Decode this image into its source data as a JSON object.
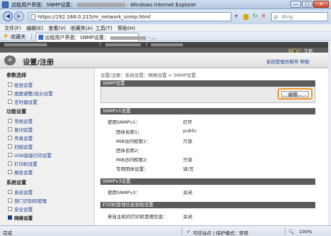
{
  "window": {
    "title": "远程用户界面：SNMP设置：",
    "title_suffix": "- Windows Internet Explorer",
    "min": "—",
    "max": "□",
    "close": "✕"
  },
  "address": {
    "back": "◀",
    "forward": "▶",
    "url_prefix": "https://192.168.0.215/",
    "url_suffix": "m_network_snmp.html",
    "search_placeholder": "Bing",
    "go_icon": "▾",
    "refresh_icon": "↻",
    "stop_icon": "✕",
    "search_icon": "ρ"
  },
  "menu": [
    "文件(F)",
    "编辑(E)",
    "查看(V)",
    "收藏夹(A)",
    "工具(T)",
    "帮助(H)"
  ],
  "favbar": {
    "label": "收藏夹",
    "star_icon": "★",
    "tab_label": "远程用户界面：SNMP设置：",
    "tab_suffix": "- ..."
  },
  "page": {
    "slash": "/",
    "logout_label": "到门户",
    "logout_link": "注销",
    "logo": "✳",
    "header_title": "设置/注册",
    "admin_link": "系统管理员邮件  帮助"
  },
  "sidebar": {
    "groups": [
      {
        "title": "参数选择",
        "items": [
          "纸张设置",
          "画面调整/显示设置",
          "定时器设置"
        ]
      },
      {
        "title": "功能设置",
        "items": [
          "常规设置",
          "复印设置",
          "传真设置",
          "扫描设置",
          "USB直接打印设置",
          "打印机设置",
          "报告设置"
        ]
      },
      {
        "title": "系统设置",
        "items": [
          "系统设置",
          "部门识别码管理",
          "安全设置",
          "网络设置"
        ]
      }
    ]
  },
  "main": {
    "breadcrumb": "设置/注册：系统设置：网络设置 > SNMP设置",
    "snmp_head": "SNMP设置",
    "edit_button": "编辑...",
    "v1_head": "SNMPv1设置",
    "v1_rows": [
      {
        "label": "使用SNMPv1：",
        "value": "打开"
      },
      {
        "label": "团体名称1：",
        "value": "public"
      },
      {
        "label": "MIB访问权限1：",
        "value": "只读"
      },
      {
        "label": "团体名称2：",
        "value": ""
      },
      {
        "label": "MIB访问权限2：",
        "value": "只读"
      },
      {
        "label": "专用团体设置：",
        "value": "读/写"
      }
    ],
    "v3_head": "SNMPv3设置",
    "v3_rows": [
      {
        "label": "使用SNMPv3：",
        "value": "关闭"
      }
    ],
    "mgmt_head": "打印机管理信息获取设置",
    "mgmt_rows": [
      {
        "label": "来自主机的打印机管理信息：",
        "value": "关闭"
      }
    ]
  },
  "status": {
    "left": "完成",
    "zone": "可信站点 | 保护模式：禁用",
    "zoom": "100%",
    "zone_icon": "✔",
    "zoom_icon": "🔍"
  }
}
